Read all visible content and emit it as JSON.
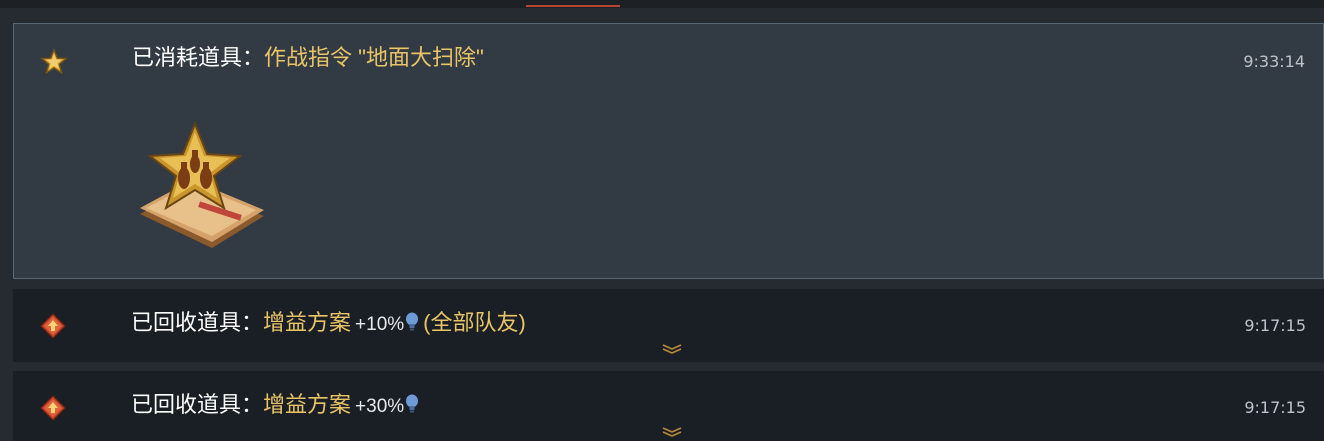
{
  "colors": {
    "background": "#262b31",
    "expanded_entry_bg": "#323a43",
    "collapsed_entry_bg": "#1a1f25",
    "item_highlight": "#e9c467",
    "time_text": "#bcc3ca",
    "active_tab_indicator": "#b4472f"
  },
  "log": [
    {
      "icon": "gold-star-icon",
      "action": "已消耗道具",
      "separator": "：",
      "item_name": "作战指令 \"地面大扫除\"",
      "time": "9:33:14",
      "expanded": true,
      "image": "ground-sweep-order-icon"
    },
    {
      "icon": "orange-diamond-upgrade-icon",
      "action": "已回收道具",
      "separator": "：",
      "item_name": "增益方案",
      "amount": "+10%",
      "scope": "(全部队友)",
      "time": "9:17:15",
      "expanded": false
    },
    {
      "icon": "orange-diamond-upgrade-icon",
      "action": "已回收道具",
      "separator": "：",
      "item_name": "增益方案",
      "amount": "+30%",
      "time": "9:17:15",
      "expanded": false
    }
  ]
}
